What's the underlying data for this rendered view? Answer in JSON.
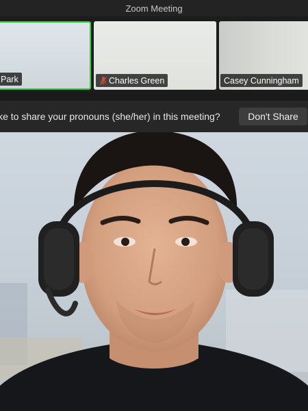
{
  "window": {
    "title": "Zoom Meeting"
  },
  "participants": [
    {
      "name": "Park",
      "active_speaker": true,
      "muted": false
    },
    {
      "name": "Charles Green",
      "active_speaker": false,
      "muted": true
    },
    {
      "name": "Casey Cunningham",
      "active_speaker": false,
      "muted": false
    }
  ],
  "banner": {
    "text": "ike to share your pronouns (she/her) in this meeting?",
    "button_label": "Don't Share"
  },
  "colors": {
    "active_speaker_border": "#2ed13a",
    "muted_mic": "#e0463a"
  }
}
